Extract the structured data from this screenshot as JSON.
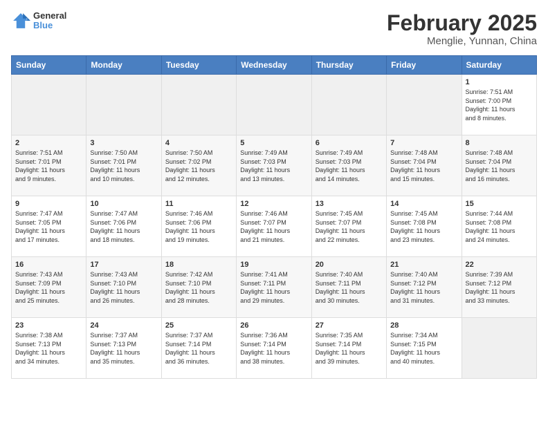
{
  "header": {
    "logo": {
      "general": "General",
      "blue": "Blue"
    },
    "title": "February 2025",
    "subtitle": "Menglie, Yunnan, China"
  },
  "weekdays": [
    "Sunday",
    "Monday",
    "Tuesday",
    "Wednesday",
    "Thursday",
    "Friday",
    "Saturday"
  ],
  "weeks": [
    [
      {
        "day": "",
        "info": ""
      },
      {
        "day": "",
        "info": ""
      },
      {
        "day": "",
        "info": ""
      },
      {
        "day": "",
        "info": ""
      },
      {
        "day": "",
        "info": ""
      },
      {
        "day": "",
        "info": ""
      },
      {
        "day": "1",
        "info": "Sunrise: 7:51 AM\nSunset: 7:00 PM\nDaylight: 11 hours\nand 8 minutes."
      }
    ],
    [
      {
        "day": "2",
        "info": "Sunrise: 7:51 AM\nSunset: 7:01 PM\nDaylight: 11 hours\nand 9 minutes."
      },
      {
        "day": "3",
        "info": "Sunrise: 7:50 AM\nSunset: 7:01 PM\nDaylight: 11 hours\nand 10 minutes."
      },
      {
        "day": "4",
        "info": "Sunrise: 7:50 AM\nSunset: 7:02 PM\nDaylight: 11 hours\nand 12 minutes."
      },
      {
        "day": "5",
        "info": "Sunrise: 7:49 AM\nSunset: 7:03 PM\nDaylight: 11 hours\nand 13 minutes."
      },
      {
        "day": "6",
        "info": "Sunrise: 7:49 AM\nSunset: 7:03 PM\nDaylight: 11 hours\nand 14 minutes."
      },
      {
        "day": "7",
        "info": "Sunrise: 7:48 AM\nSunset: 7:04 PM\nDaylight: 11 hours\nand 15 minutes."
      },
      {
        "day": "8",
        "info": "Sunrise: 7:48 AM\nSunset: 7:04 PM\nDaylight: 11 hours\nand 16 minutes."
      }
    ],
    [
      {
        "day": "9",
        "info": "Sunrise: 7:47 AM\nSunset: 7:05 PM\nDaylight: 11 hours\nand 17 minutes."
      },
      {
        "day": "10",
        "info": "Sunrise: 7:47 AM\nSunset: 7:06 PM\nDaylight: 11 hours\nand 18 minutes."
      },
      {
        "day": "11",
        "info": "Sunrise: 7:46 AM\nSunset: 7:06 PM\nDaylight: 11 hours\nand 19 minutes."
      },
      {
        "day": "12",
        "info": "Sunrise: 7:46 AM\nSunset: 7:07 PM\nDaylight: 11 hours\nand 21 minutes."
      },
      {
        "day": "13",
        "info": "Sunrise: 7:45 AM\nSunset: 7:07 PM\nDaylight: 11 hours\nand 22 minutes."
      },
      {
        "day": "14",
        "info": "Sunrise: 7:45 AM\nSunset: 7:08 PM\nDaylight: 11 hours\nand 23 minutes."
      },
      {
        "day": "15",
        "info": "Sunrise: 7:44 AM\nSunset: 7:08 PM\nDaylight: 11 hours\nand 24 minutes."
      }
    ],
    [
      {
        "day": "16",
        "info": "Sunrise: 7:43 AM\nSunset: 7:09 PM\nDaylight: 11 hours\nand 25 minutes."
      },
      {
        "day": "17",
        "info": "Sunrise: 7:43 AM\nSunset: 7:10 PM\nDaylight: 11 hours\nand 26 minutes."
      },
      {
        "day": "18",
        "info": "Sunrise: 7:42 AM\nSunset: 7:10 PM\nDaylight: 11 hours\nand 28 minutes."
      },
      {
        "day": "19",
        "info": "Sunrise: 7:41 AM\nSunset: 7:11 PM\nDaylight: 11 hours\nand 29 minutes."
      },
      {
        "day": "20",
        "info": "Sunrise: 7:40 AM\nSunset: 7:11 PM\nDaylight: 11 hours\nand 30 minutes."
      },
      {
        "day": "21",
        "info": "Sunrise: 7:40 AM\nSunset: 7:12 PM\nDaylight: 11 hours\nand 31 minutes."
      },
      {
        "day": "22",
        "info": "Sunrise: 7:39 AM\nSunset: 7:12 PM\nDaylight: 11 hours\nand 33 minutes."
      }
    ],
    [
      {
        "day": "23",
        "info": "Sunrise: 7:38 AM\nSunset: 7:13 PM\nDaylight: 11 hours\nand 34 minutes."
      },
      {
        "day": "24",
        "info": "Sunrise: 7:37 AM\nSunset: 7:13 PM\nDaylight: 11 hours\nand 35 minutes."
      },
      {
        "day": "25",
        "info": "Sunrise: 7:37 AM\nSunset: 7:14 PM\nDaylight: 11 hours\nand 36 minutes."
      },
      {
        "day": "26",
        "info": "Sunrise: 7:36 AM\nSunset: 7:14 PM\nDaylight: 11 hours\nand 38 minutes."
      },
      {
        "day": "27",
        "info": "Sunrise: 7:35 AM\nSunset: 7:14 PM\nDaylight: 11 hours\nand 39 minutes."
      },
      {
        "day": "28",
        "info": "Sunrise: 7:34 AM\nSunset: 7:15 PM\nDaylight: 11 hours\nand 40 minutes."
      },
      {
        "day": "",
        "info": ""
      }
    ]
  ]
}
